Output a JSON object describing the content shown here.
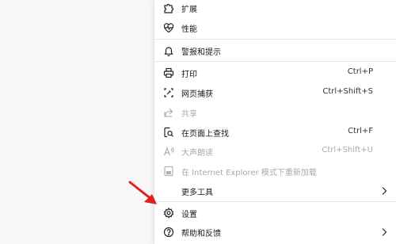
{
  "menu": {
    "items": [
      {
        "label": "扩展",
        "icon": "puzzle-icon"
      },
      {
        "label": "性能",
        "icon": "heartbeat-icon"
      },
      {
        "label": "警报和提示",
        "icon": "bell-icon"
      },
      {
        "label": "打印",
        "shortcut": "Ctrl+P",
        "icon": "printer-icon"
      },
      {
        "label": "网页捕获",
        "shortcut": "Ctrl+Shift+S",
        "icon": "web-capture-icon"
      },
      {
        "label": "共享",
        "icon": "share-icon",
        "disabled": true
      },
      {
        "label": "在页面上查找",
        "shortcut": "Ctrl+F",
        "icon": "find-icon"
      },
      {
        "label": "大声朗读",
        "shortcut": "Ctrl+Shift+U",
        "icon": "read-aloud-icon",
        "disabled": true
      },
      {
        "label": "在 Internet Explorer 模式下重新加载",
        "icon": "ie-mode-icon",
        "disabled": true
      },
      {
        "label": "更多工具",
        "icon": "",
        "submenu": true
      },
      {
        "label": "设置",
        "icon": "gear-icon"
      },
      {
        "label": "帮助和反馈",
        "icon": "help-icon",
        "submenu": true
      }
    ]
  },
  "colors": {
    "annotation_arrow": "#e0201b",
    "disabled_text": "#a9a9a9"
  }
}
